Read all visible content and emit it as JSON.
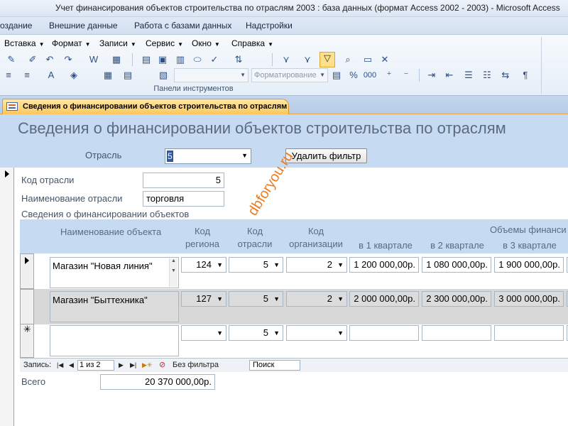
{
  "window": {
    "title": "Учет финансирования объектов строительства по отраслям 2003 : база данных (формат Access 2002 - 2003)  -  Microsoft Access"
  },
  "ribbon": {
    "tabs": [
      "оздание",
      "Внешние данные",
      "Работа с базами данных",
      "Надстройки"
    ]
  },
  "toolbar": {
    "menus": [
      "Вставка",
      "Формат",
      "Записи",
      "Сервис",
      "Окно",
      "Справка"
    ],
    "font_combo": "Форматирование",
    "panel_label": "Панели инструментов",
    "icons": [
      "insert-icon",
      "format-painter-icon",
      "undo-icon",
      "redo-icon",
      "word-icon",
      "excel-icon",
      "table-icon",
      "properties-icon",
      "window-icon",
      "chart-icon",
      "spell-icon",
      "filter-by-selection-icon",
      "filter-by-form-icon",
      "apply-filter-icon",
      "sort-icon",
      "delete-icon",
      "align-left-icon",
      "align-center-icon",
      "font-color-icon",
      "fill-color-icon",
      "border-icon",
      "gridlines-icon",
      "percent-icon",
      "decimal-icon",
      "comma-icon",
      "increase-decimal-icon",
      "decrease-decimal-icon",
      "indent-icon",
      "paragraph-icon"
    ],
    "percent_glyph": "%",
    "thousands_glyph": "000"
  },
  "document_tab": {
    "title": "Сведения о финансировании объектов строительства по отраслям"
  },
  "form": {
    "title": "Сведения о финансировании объектов строительства по отраслям",
    "branch_label": "Отрасль",
    "branch_value": "5",
    "remove_filter_label": "Удалить фильтр"
  },
  "record": {
    "code_label": "Код отрасли",
    "code_value": "5",
    "name_label": "Наименование отрасли",
    "name_value": "торговля",
    "subform_label": "Сведения о финансировании объектов"
  },
  "subform": {
    "columns": {
      "object_name": "Наименование объекта",
      "region_code": "Код\nрегиона",
      "branch_code": "Код\nотрасли",
      "org_code": "Код\nорганизации",
      "financing_group": "Объемы финанси",
      "q1": "в 1 квартале",
      "q2": "в 2 квартале",
      "q3": "в 3 квартале"
    },
    "rows": [
      {
        "name": "Магазин \"Новая линия\"",
        "region": "124",
        "branch": "5",
        "org": "2",
        "q1": "1 200 000,00р.",
        "q2": "1 080 000,00р.",
        "q3": "1 900 000,00р."
      },
      {
        "name": "Магазин \"Быттехника\"",
        "region": "127",
        "branch": "5",
        "org": "2",
        "q1": "2 000 000,00р.",
        "q2": "2 300 000,00р.",
        "q3": "3 000 000,00р."
      },
      {
        "name": "",
        "region": "",
        "branch": "5",
        "org": "",
        "q1": "",
        "q2": "",
        "q3": ""
      }
    ],
    "new_record_marker": "✳",
    "navigation": {
      "record_label": "Запись:",
      "position": "1 из 2",
      "no_filter": "Без фильтра",
      "search": "Поиск"
    }
  },
  "total": {
    "label": "Всего",
    "value": "20 370 000,00р."
  },
  "watermark": "dbforyou.ru"
}
